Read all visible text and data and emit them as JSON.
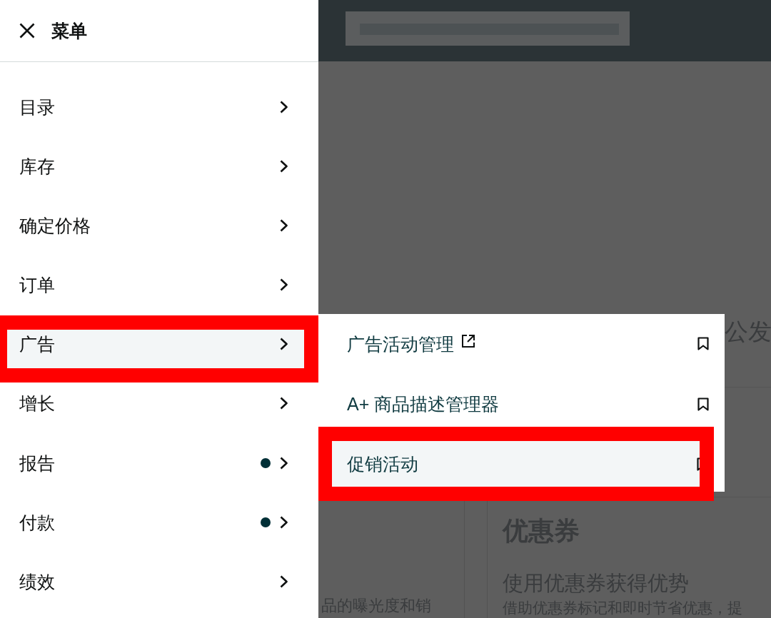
{
  "menu": {
    "title": "菜单",
    "items": [
      {
        "label": "目录",
        "selected": false,
        "dot": false,
        "annotated": false
      },
      {
        "label": "库存",
        "selected": false,
        "dot": false,
        "annotated": false
      },
      {
        "label": "确定价格",
        "selected": false,
        "dot": false,
        "annotated": false
      },
      {
        "label": "订单",
        "selected": false,
        "dot": false,
        "annotated": false
      },
      {
        "label": "广告",
        "selected": true,
        "dot": false,
        "annotated": true
      },
      {
        "label": "增长",
        "selected": false,
        "dot": false,
        "annotated": false
      },
      {
        "label": "报告",
        "selected": false,
        "dot": true,
        "annotated": false
      },
      {
        "label": "付款",
        "selected": false,
        "dot": true,
        "annotated": false
      },
      {
        "label": "绩效",
        "selected": false,
        "dot": false,
        "annotated": false
      }
    ]
  },
  "submenu": {
    "items": [
      {
        "label": "广告活动管理",
        "external": true,
        "bookmarked": false,
        "selected": false,
        "annotated": false
      },
      {
        "label": "A+ 商品描述管理器",
        "external": false,
        "bookmarked": false,
        "selected": false,
        "annotated": false
      },
      {
        "label": "促销活动",
        "external": false,
        "bookmarked": false,
        "selected": true,
        "annotated": true
      }
    ]
  },
  "page": {
    "banner_text": "公发",
    "cards": [
      {
        "description": "品的曝光度和销"
      },
      {
        "title": "优惠券",
        "subtitle": "使用优惠券获得优势",
        "description": "借助优惠券标记和即时节省优惠，提"
      }
    ]
  }
}
